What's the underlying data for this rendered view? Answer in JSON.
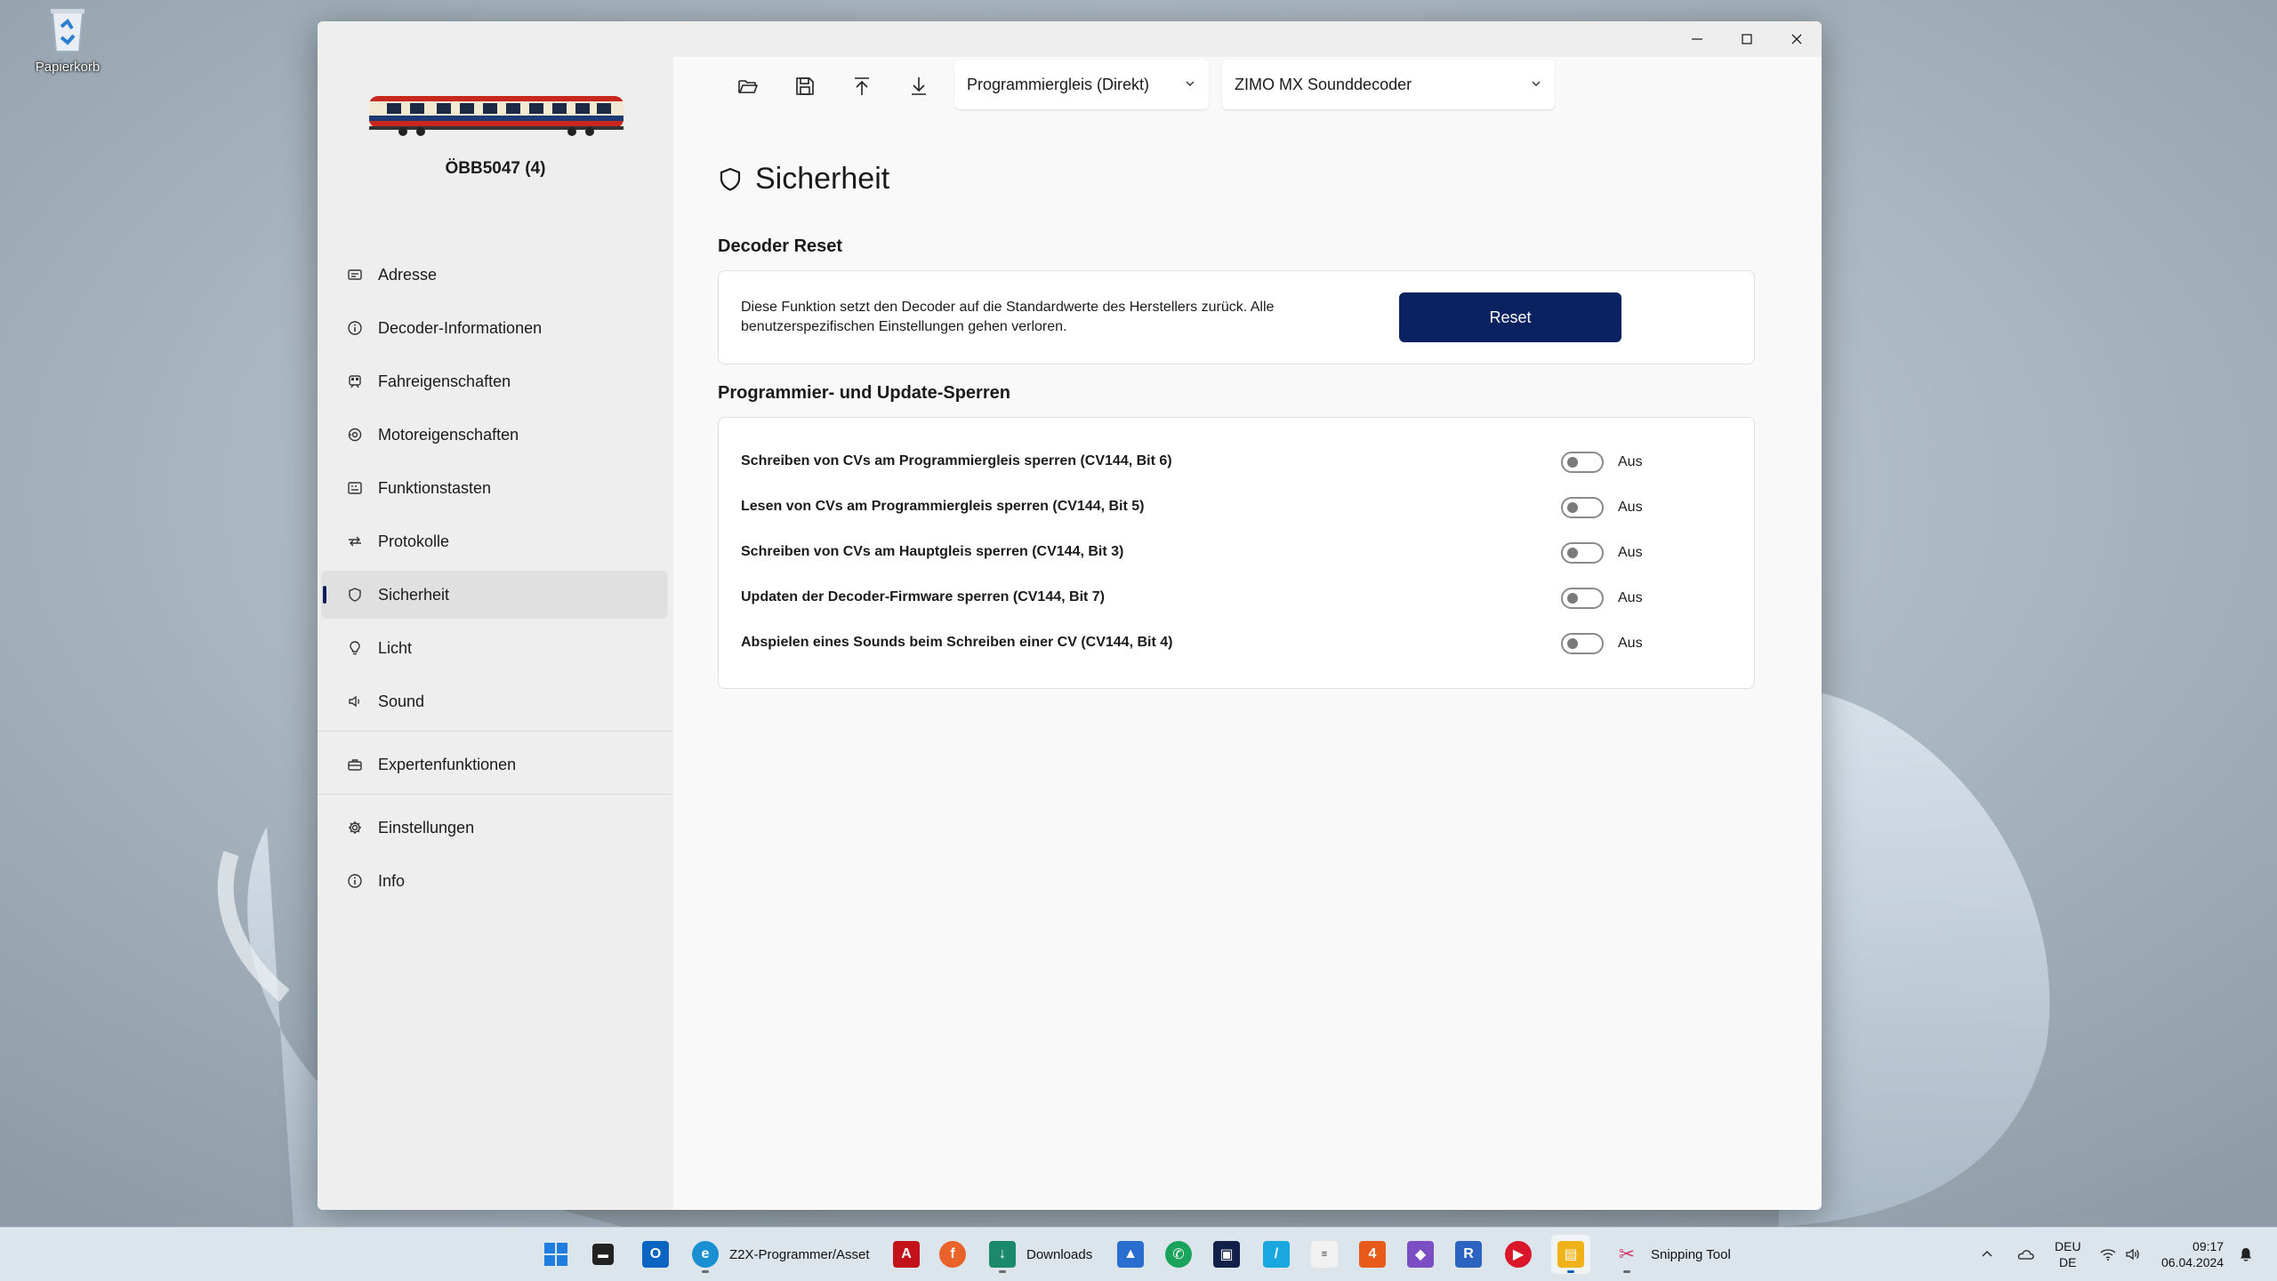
{
  "desktop": {
    "recycle_bin_label": "Papierkorb"
  },
  "window": {
    "loco_name": "ÖBB5047 (4)",
    "controls": [
      "minimize",
      "maximize",
      "close"
    ]
  },
  "sidebar": {
    "items": [
      {
        "label": "Adresse",
        "icon": "address-card-icon"
      },
      {
        "label": "Decoder-Informationen",
        "icon": "info-icon"
      },
      {
        "label": "Fahreigenschaften",
        "icon": "train-icon"
      },
      {
        "label": "Motoreigenschaften",
        "icon": "motor-icon"
      },
      {
        "label": "Funktionstasten",
        "icon": "keys-icon"
      },
      {
        "label": "Protokolle",
        "icon": "arrows-icon"
      },
      {
        "label": "Sicherheit",
        "icon": "shield-icon",
        "active": true
      },
      {
        "label": "Licht",
        "icon": "bulb-icon"
      },
      {
        "label": "Sound",
        "icon": "speaker-icon"
      },
      {
        "label": "Expertenfunktionen",
        "icon": "toolbox-icon"
      },
      {
        "label": "Einstellungen",
        "icon": "gear-icon"
      },
      {
        "label": "Info",
        "icon": "info-icon"
      }
    ]
  },
  "toolbar": {
    "track_select": "Programmiergleis (Direkt)",
    "decoder_select": "ZIMO MX Sounddecoder"
  },
  "page": {
    "title": "Sicherheit",
    "reset_section": {
      "title": "Decoder Reset",
      "description": "Diese Funktion setzt den Decoder auf die Standardwerte des Herstellers zurück. Alle benutzerspezifischen Einstellungen gehen verloren.",
      "button": "Reset"
    },
    "locks_section": {
      "title": "Programmier- und Update-Sperren",
      "rows": [
        {
          "label": "Schreiben von CVs am Programmiergleis sperren (CV144, Bit 6)",
          "state": "Aus",
          "on": false
        },
        {
          "label": "Lesen von CVs am Programmiergleis sperren (CV144, Bit 5)",
          "state": "Aus",
          "on": false
        },
        {
          "label": "Schreiben von CVs am Hauptgleis sperren (CV144, Bit 3)",
          "state": "Aus",
          "on": false
        },
        {
          "label": "Updaten der Decoder-Firmware sperren (CV144, Bit 7)",
          "state": "Aus",
          "on": false
        },
        {
          "label": "Abspielen eines Sounds beim Schreiben einer CV (CV144, Bit 4)",
          "state": "Aus",
          "on": false
        }
      ]
    }
  },
  "taskbar": {
    "edge_label": "Z2X-Programmer/Asset",
    "downloads_label": "Downloads",
    "snipping_label": "Snipping Tool",
    "lang_top": "DEU",
    "lang_bottom": "DE",
    "time": "09:17",
    "date": "06.04.2024"
  },
  "colors": {
    "accent": "#0b2260",
    "taskbar": "#dde5ec",
    "sidebar": "#eeeeee"
  }
}
